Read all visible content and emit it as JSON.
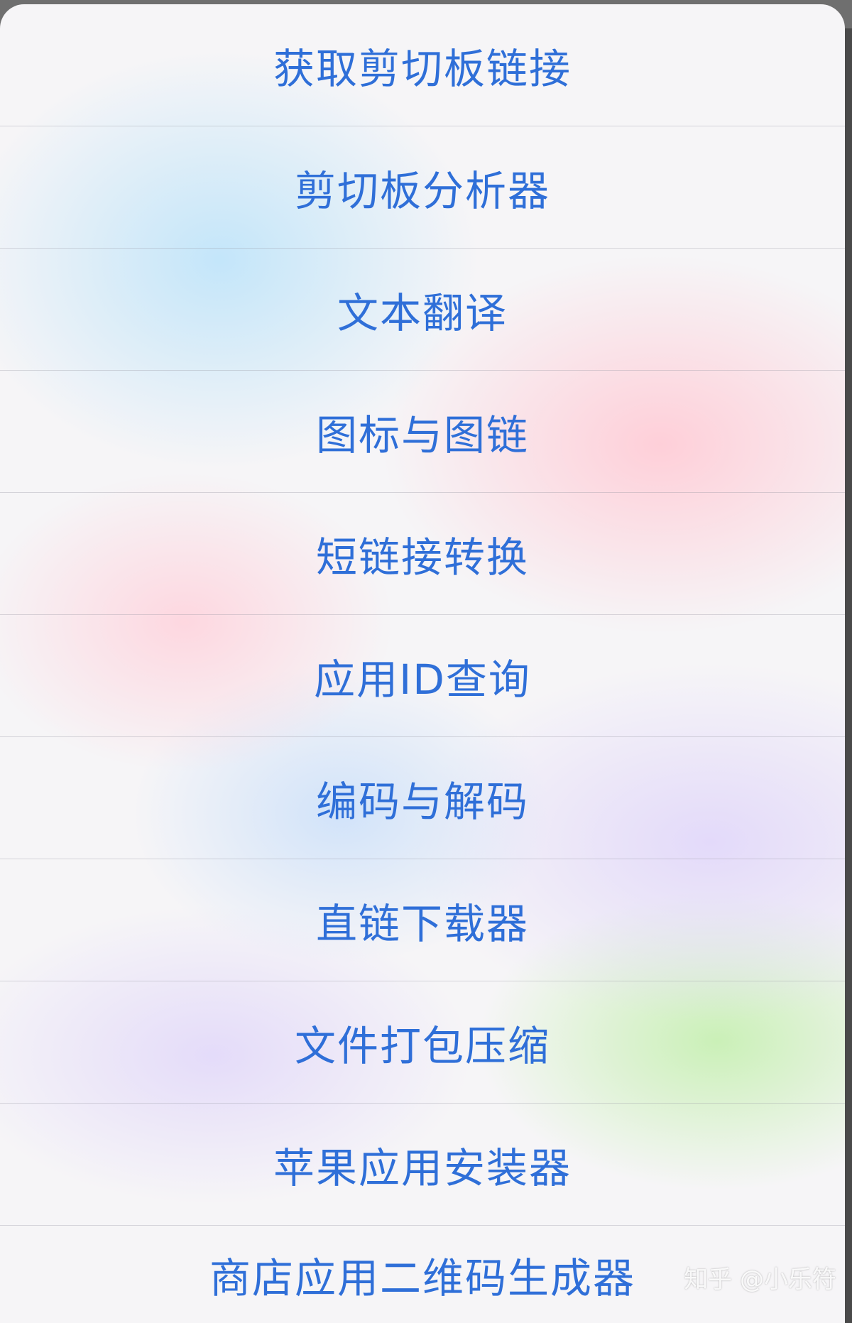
{
  "action_sheet": {
    "items": [
      {
        "label": "获取剪切板链接"
      },
      {
        "label": "剪切板分析器"
      },
      {
        "label": "文本翻译"
      },
      {
        "label": "图标与图链"
      },
      {
        "label": "短链接转换"
      },
      {
        "label": "应用ID查询"
      },
      {
        "label": "编码与解码"
      },
      {
        "label": "直链下载器"
      },
      {
        "label": "文件打包压缩"
      },
      {
        "label": "苹果应用安装器"
      },
      {
        "label": "商店应用二维码生成器"
      }
    ]
  },
  "watermark": {
    "text": "知乎 @小乐符"
  },
  "colors": {
    "accent": "#2f6fd8"
  }
}
